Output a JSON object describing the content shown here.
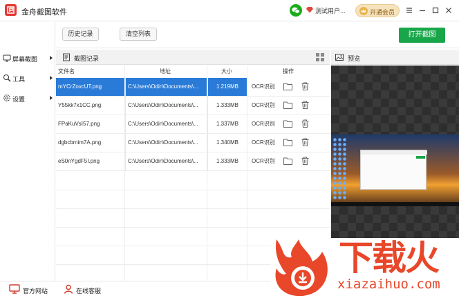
{
  "app": {
    "title": "金舟截图软件",
    "user_name": "测试用户..."
  },
  "header": {
    "vip_label": "开通会员"
  },
  "toolbar": {
    "history_label": "历史记录",
    "clear_label": "清空列表",
    "open_label": "打开截图"
  },
  "sidebar": {
    "items": [
      {
        "label": "屏幕截图",
        "icon": "monitor-icon"
      },
      {
        "label": "工具",
        "icon": "wrench-icon"
      },
      {
        "label": "设置",
        "icon": "gear-icon"
      }
    ]
  },
  "records": {
    "title": "截图记录",
    "columns": {
      "name": "文件名",
      "path": "地址",
      "size": "大小",
      "action": "操作"
    },
    "ocr_label": "OCR识别",
    "rows": [
      {
        "name": "mYCrZovcUT.png",
        "path": "C:\\Users\\Odin\\Documents\\...",
        "size": "1.219MB"
      },
      {
        "name": "Y55kk7x1CC.png",
        "path": "C:\\Users\\Odin\\Documents\\...",
        "size": "1.333MB"
      },
      {
        "name": "FPaKuVsI57.png",
        "path": "C:\\Users\\Odin\\Documents\\...",
        "size": "1.337MB"
      },
      {
        "name": "dgbcbmim7A.png",
        "path": "C:\\Users\\Odin\\Documents\\...",
        "size": "1.340MB"
      },
      {
        "name": "eS0nYgdF5I.png",
        "path": "C:\\Users\\Odin\\Documents\\...",
        "size": "1.333MB"
      }
    ]
  },
  "preview": {
    "title": "预览"
  },
  "footer": {
    "website_label": "官方网站",
    "support_label": "在线客服"
  },
  "watermark": {
    "big": "下载火",
    "small": "xiazaihuo.com"
  },
  "colors": {
    "accent_green": "#19a64a",
    "selected_blue": "#2a7bd8",
    "brand_red": "#e53935",
    "watermark_orange": "#e8472a"
  }
}
